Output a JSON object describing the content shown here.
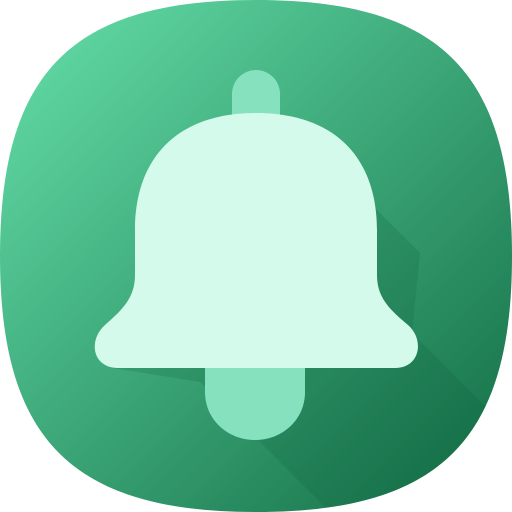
{
  "icon": {
    "name": "bell-icon",
    "colors": {
      "gradient_start": "#66E0AB",
      "gradient_end": "#116B43",
      "bell_body": "#D4FAEB",
      "bell_parts": "#86E1BF",
      "long_shadow": "#0B5A36"
    }
  }
}
